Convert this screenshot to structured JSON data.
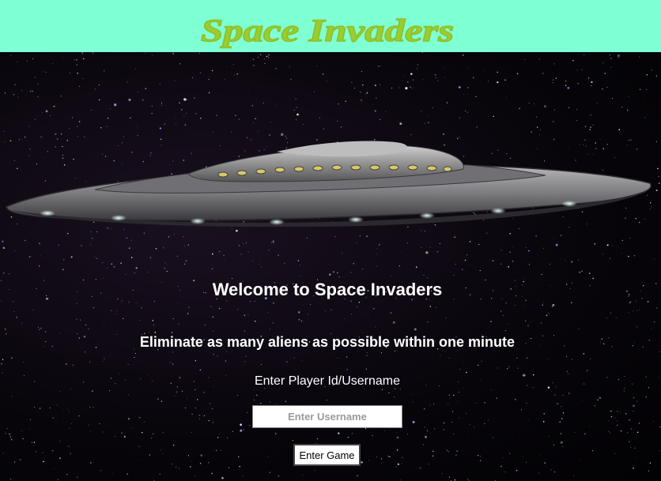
{
  "header": {
    "title": "Space Invaders",
    "background_color": "#7fffd4",
    "title_color": "#9acd32"
  },
  "main": {
    "welcome": "Welcome to Space Invaders",
    "tagline": "Eliminate as many aliens as possible within one minute",
    "prompt": "Enter Player Id/Username",
    "username_field": {
      "placeholder": "Enter Username",
      "value": ""
    },
    "enter_button_label": "Enter Game"
  },
  "icons": {
    "hero_image": "ufo-flying-saucer",
    "background": "starfield"
  }
}
